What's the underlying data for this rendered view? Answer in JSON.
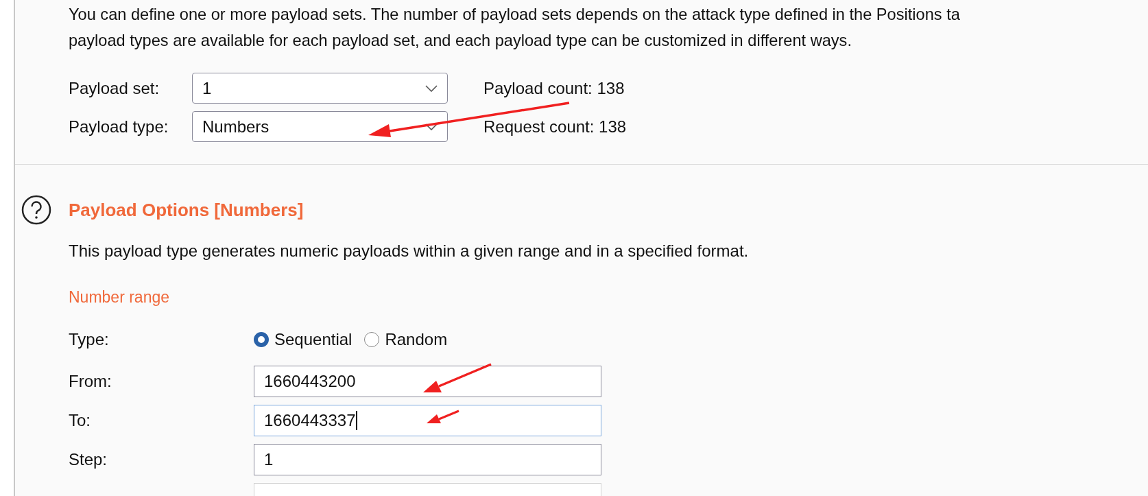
{
  "description_lines": [
    "You can define one or more payload sets. The number of payload sets depends on the attack type defined in the Positions ta",
    "payload types are available for each payload set, and each payload type can be customized in different ways."
  ],
  "selectors": [
    {
      "label": "Payload set:",
      "value": "1",
      "count": "Payload count: 138"
    },
    {
      "label": "Payload type:",
      "value": "Numbers",
      "count": "Request count: 138"
    }
  ],
  "section": {
    "title": "Payload Options [Numbers]",
    "description": "This payload type generates numeric payloads within a given range and in a specified format.",
    "group_title": "Number range",
    "type_row": {
      "label": "Type:",
      "options": [
        {
          "label": "Sequential",
          "selected": true
        },
        {
          "label": "Random",
          "selected": false
        }
      ]
    },
    "fields": [
      {
        "label": "From:",
        "value": "1660443200",
        "focused": false,
        "disabled": false
      },
      {
        "label": "To:",
        "value": "1660443337",
        "focused": true,
        "disabled": false
      },
      {
        "label": "Step:",
        "value": "1",
        "focused": false,
        "disabled": false
      },
      {
        "focused": false,
        "disabled": true
      }
    ]
  }
}
